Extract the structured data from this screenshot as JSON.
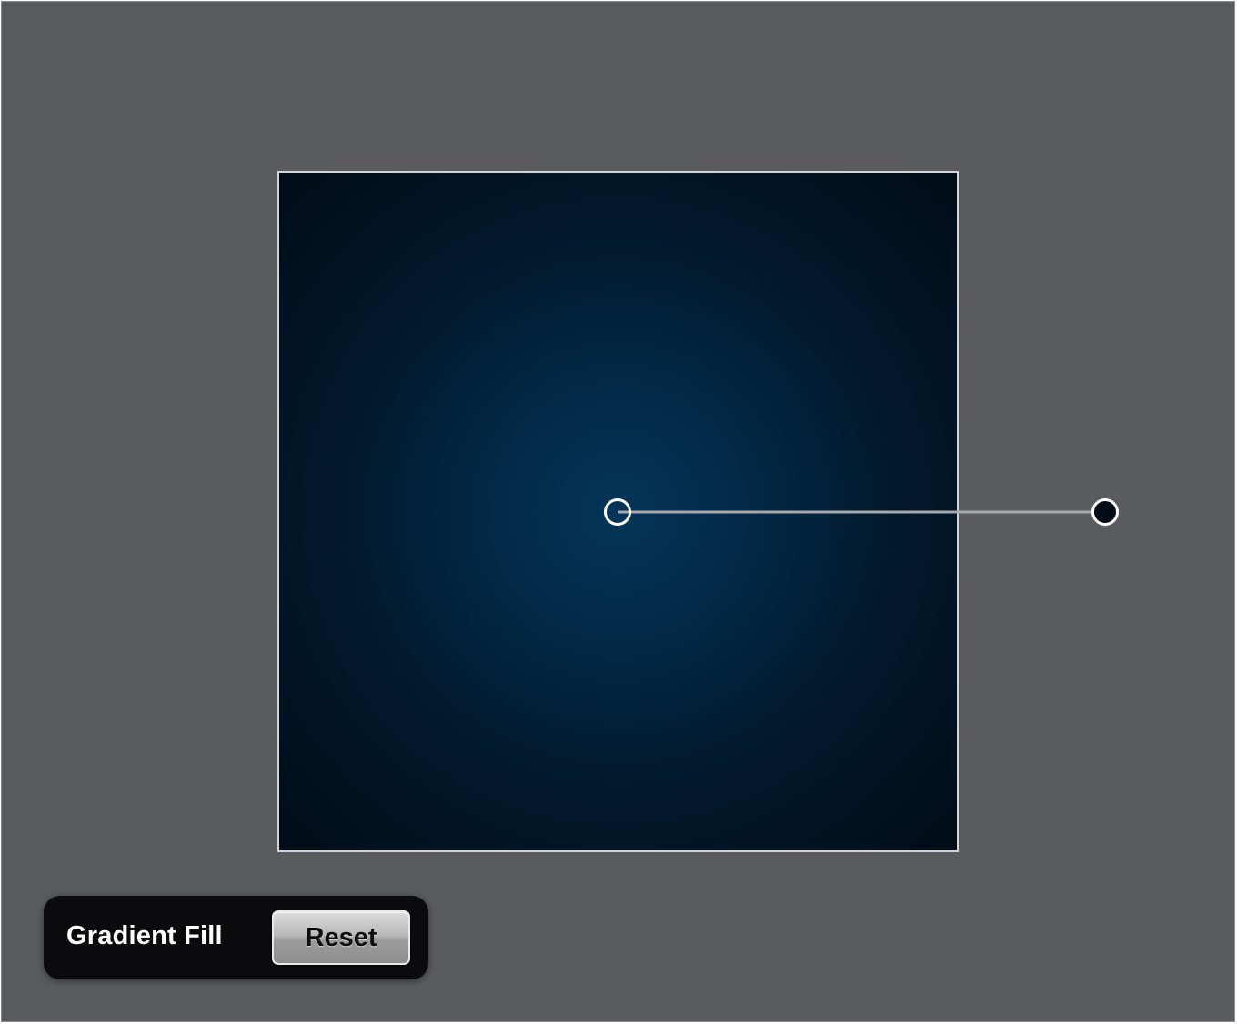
{
  "canvas": {
    "background_color": "#5a5b5f"
  },
  "gradient": {
    "type": "radial",
    "center_color": "#043559",
    "edge_color": "#010c17",
    "start_handle": {
      "icon": "circle-handle-open-icon"
    },
    "end_handle": {
      "icon": "circle-handle-filled-icon"
    }
  },
  "hud": {
    "label": "Gradient Fill",
    "reset_label": "Reset"
  }
}
